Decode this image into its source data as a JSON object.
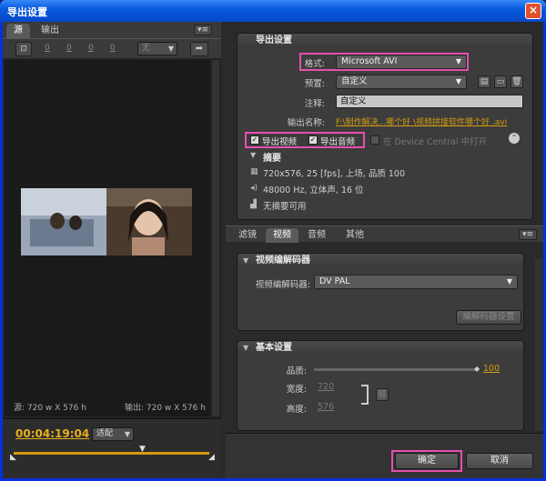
{
  "window": {
    "title": "导出设置",
    "close_icon": "close-icon"
  },
  "left": {
    "tabs": [
      {
        "label": "源"
      },
      {
        "label": "输出"
      }
    ],
    "crop_values": [
      "0",
      "0",
      "0",
      "0"
    ],
    "crop_preset": "无",
    "source_info": "源: 720 w X 576 h",
    "output_info": "输出: 720 w X 576 h",
    "timecode": "00:04:19:04",
    "fit_label": "适配"
  },
  "export": {
    "header": "导出设置",
    "format_label": "格式:",
    "format_value": "Microsoft AVI",
    "preset_label": "预置:",
    "preset_value": "自定义",
    "comment_label": "注释:",
    "comment_value": "自定义",
    "output_label": "输出名称:",
    "output_value": "F:\\制作解决...哪个好 \\视频拼接软件哪个好 .avi",
    "export_video_label": "导出视频",
    "export_audio_label": "导出音频",
    "device_central_label": "在 Device Central 中打开",
    "summary_header": "摘要",
    "summary_video": "720x576, 25 [fps], 上场, 品质 100",
    "summary_audio": "48000 Hz, 立体声, 16 位",
    "summary_none": "无摘要可用"
  },
  "tabs2": [
    {
      "label": "滤镜"
    },
    {
      "label": "视频"
    },
    {
      "label": "音频"
    },
    {
      "label": "其他"
    }
  ],
  "codec": {
    "header": "视频编解码器",
    "codec_label": "视频编解码器:",
    "codec_value": "DV PAL",
    "codec_settings": "编解码器设置"
  },
  "basic": {
    "header": "基本设置",
    "quality_label": "品质:",
    "quality_value": "100",
    "width_label": "宽度:",
    "width_value": "720",
    "height_label": "高度:",
    "height_value": "576"
  },
  "buttons": {
    "ok": "确定",
    "cancel": "取消"
  }
}
